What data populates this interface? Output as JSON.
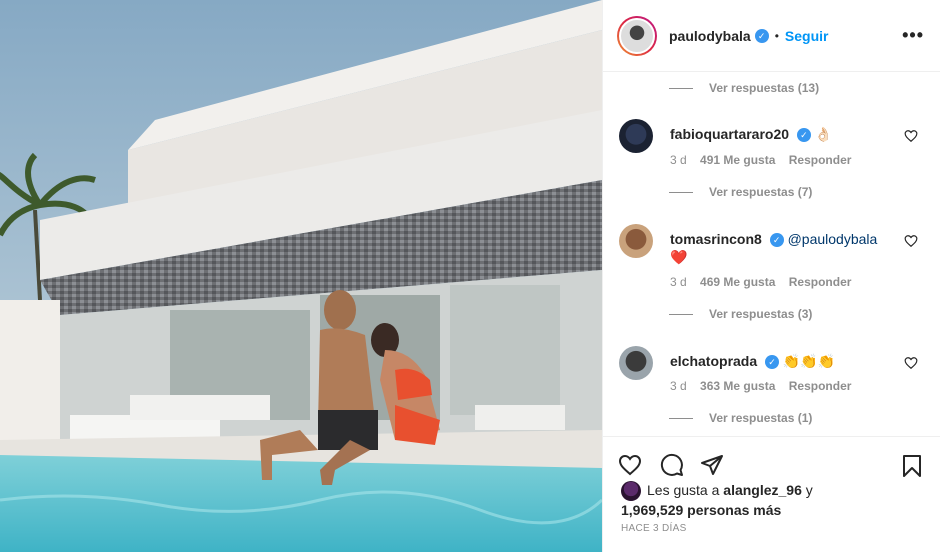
{
  "post": {
    "username": "paulodybala",
    "follow_label": "Seguir",
    "more_label": "•••"
  },
  "comments": [
    {
      "type": "replies",
      "label": "Ver respuestas (13)"
    },
    {
      "user": "fabioquartararo20",
      "text": "👌🏻",
      "time": "3 d",
      "likes": "491 Me gusta",
      "reply": "Responder"
    },
    {
      "type": "replies",
      "label": "Ver respuestas (7)"
    },
    {
      "user": "tomasrincon8",
      "mention": "@paulodybala",
      "text": "❤️",
      "time": "3 d",
      "likes": "469 Me gusta",
      "reply": "Responder"
    },
    {
      "type": "replies",
      "label": "Ver respuestas (3)"
    },
    {
      "user": "elchatoprada",
      "text": "👏👏👏",
      "time": "3 d",
      "likes": "363 Me gusta",
      "reply": "Responder"
    },
    {
      "type": "replies",
      "label": "Ver respuestas (1)"
    }
  ],
  "likes_line": {
    "prefix": "Les gusta a ",
    "first_user": "alanglez_96",
    "conj": " y",
    "count": "1,969,529 personas más"
  },
  "time_ago": "HACE 3 DÍAS",
  "colors": {
    "accent": "#0095f6",
    "verified": "#3897f0",
    "heart": "#ed4956"
  }
}
